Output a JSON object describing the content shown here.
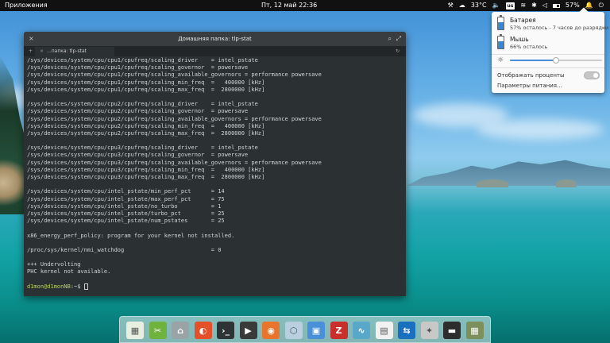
{
  "top_panel": {
    "applications_label": "Приложения",
    "clock": "Пт, 12 май  22:36",
    "temperature": "33°C",
    "keyboard_layout": "us",
    "battery_percent": "57%"
  },
  "battery_popover": {
    "battery": {
      "title": "Батарея",
      "status": "57% осталось - 7 часов до разрядки"
    },
    "mouse": {
      "title": "Мышь",
      "status": "66% осталось"
    },
    "brightness_level": 0.5,
    "show_percent_label": "Отображать проценты",
    "show_percent_enabled": false,
    "power_settings_label": "Параметры питания..."
  },
  "terminal": {
    "title": "Домашняя папка: tlp-stat",
    "tab_label": "...папка: tlp-stat",
    "lines": [
      "/sys/devices/system/cpu/cpu1/cpufreq/scaling_driver    = intel_pstate",
      "/sys/devices/system/cpu/cpu1/cpufreq/scaling_governor  = powersave",
      "/sys/devices/system/cpu/cpu1/cpufreq/scaling_available_governors = performance powersave",
      "/sys/devices/system/cpu/cpu1/cpufreq/scaling_min_freq  =   400000 [kHz]",
      "/sys/devices/system/cpu/cpu1/cpufreq/scaling_max_freq  =  2800000 [kHz]",
      "",
      "/sys/devices/system/cpu/cpu2/cpufreq/scaling_driver    = intel_pstate",
      "/sys/devices/system/cpu/cpu2/cpufreq/scaling_governor  = powersave",
      "/sys/devices/system/cpu/cpu2/cpufreq/scaling_available_governors = performance powersave",
      "/sys/devices/system/cpu/cpu2/cpufreq/scaling_min_freq  =   400000 [kHz]",
      "/sys/devices/system/cpu/cpu2/cpufreq/scaling_max_freq  =  2800000 [kHz]",
      "",
      "/sys/devices/system/cpu/cpu3/cpufreq/scaling_driver    = intel_pstate",
      "/sys/devices/system/cpu/cpu3/cpufreq/scaling_governor  = powersave",
      "/sys/devices/system/cpu/cpu3/cpufreq/scaling_available_governors = performance powersave",
      "/sys/devices/system/cpu/cpu3/cpufreq/scaling_min_freq  =   400000 [kHz]",
      "/sys/devices/system/cpu/cpu3/cpufreq/scaling_max_freq  =  2800000 [kHz]",
      "",
      "/sys/devices/system/cpu/intel_pstate/min_perf_pct      = 14",
      "/sys/devices/system/cpu/intel_pstate/max_perf_pct      = 75",
      "/sys/devices/system/cpu/intel_pstate/no_turbo          = 1",
      "/sys/devices/system/cpu/intel_pstate/turbo_pct         = 25",
      "/sys/devices/system/cpu/intel_pstate/num_pstates       = 25",
      "",
      "x86_energy_perf_policy: program for your kernel not installed.",
      "",
      "/proc/sys/kernel/nmi_watchdog                          = 0",
      "",
      "+++ Undervolting",
      "PHC kernel not available.",
      ""
    ],
    "prompt_user": "d1mon@d1monNB",
    "prompt_suffix": ":~$ "
  },
  "dock": {
    "items": [
      {
        "name": "spreadsheet-app-icon",
        "color": "#e9efe0"
      },
      {
        "name": "tools-app-icon",
        "color": "#6fb23e"
      },
      {
        "name": "home-folder-icon",
        "color": "#9aa3a6"
      },
      {
        "name": "office-suite-icon",
        "color": "#e4502a"
      },
      {
        "name": "terminal-app-icon",
        "color": "#2e3436"
      },
      {
        "name": "media-player-icon",
        "color": "#3a3a3a"
      },
      {
        "name": "firefox-icon",
        "color": "#e8752b"
      },
      {
        "name": "package-manager-icon",
        "color": "#b8cfe0"
      },
      {
        "name": "remote-desktop-icon",
        "color": "#4a90d9"
      },
      {
        "name": "filezilla-icon",
        "color": "#c9302c"
      },
      {
        "name": "system-monitor-icon",
        "color": "#5aa8c9"
      },
      {
        "name": "text-editor-icon",
        "color": "#f1f1f1"
      },
      {
        "name": "teamviewer-icon",
        "color": "#1a6fbf"
      },
      {
        "name": "cleaner-icon",
        "color": "#c8c8c8"
      },
      {
        "name": "screen-recorder-icon",
        "color": "#2d2d2d"
      },
      {
        "name": "calculator-icon",
        "color": "#7d8f5c"
      }
    ]
  }
}
